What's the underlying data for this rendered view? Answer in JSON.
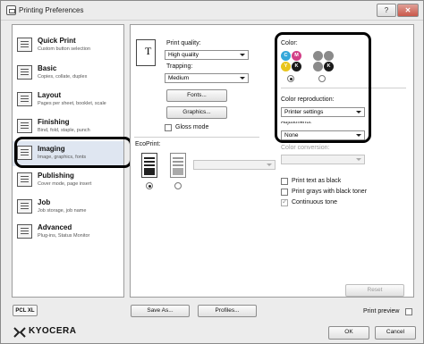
{
  "window": {
    "title": "Printing Preferences",
    "help_label": "?",
    "close_label": "✕"
  },
  "sidebar": {
    "items": [
      {
        "title": "Quick Print",
        "subtitle": "Custom button selection"
      },
      {
        "title": "Basic",
        "subtitle": "Copies, collate, duplex"
      },
      {
        "title": "Layout",
        "subtitle": "Pages per sheet, booklet, scale"
      },
      {
        "title": "Finishing",
        "subtitle": "Bind, fold, staple, punch"
      },
      {
        "title": "Imaging",
        "subtitle": "Image, graphics, fonts"
      },
      {
        "title": "Publishing",
        "subtitle": "Cover mode, page insert"
      },
      {
        "title": "Job",
        "subtitle": "Job storage, job name"
      },
      {
        "title": "Advanced",
        "subtitle": "Plug-ins, Status Monitor"
      }
    ],
    "selected": "Imaging"
  },
  "imaging": {
    "print_quality_label": "Print quality:",
    "print_quality_value": "High quality",
    "trapping_label": "Trapping:",
    "trapping_value": "Medium",
    "fonts_button": "Fonts...",
    "graphics_button": "Graphics...",
    "gloss_mode_label": "Gloss mode",
    "gloss_mode_checked": false,
    "ecoprint_label": "EcoPrint:",
    "ecoprint_select_value": "",
    "color_label": "Color:",
    "color_dots_color": [
      "C",
      "M",
      "Y",
      "K"
    ],
    "color_dots_mono": [
      "K"
    ],
    "color_mode_selected": "color",
    "color_reproduction_label": "Color reproduction:",
    "color_reproduction_value": "Printer settings",
    "adjustments_label": "Adjustments:",
    "adjustments_value": "None",
    "color_conversion_label": "Color conversion:",
    "color_conversion_value": "",
    "print_text_as_black": "Print text as black",
    "print_grays_black": "Print grays with black toner",
    "continuous_tone": "Continuous tone",
    "print_text_as_black_checked": false,
    "print_grays_black_checked": false,
    "continuous_tone_checked": true,
    "reset_button": "Reset"
  },
  "footer": {
    "profile_label": "PCL XL",
    "save_as_button": "Save As...",
    "profiles_button": "Profiles...",
    "print_preview_label": "Print preview",
    "print_preview_checked": false,
    "brand": "KYOCERA",
    "ok_button": "OK",
    "cancel_button": "Cancel"
  },
  "colors": {
    "cyan": "#35a7d9",
    "magenta": "#d23f87",
    "yellow": "#e8c51c",
    "black": "#1a1a1a",
    "mono_gray": "#8a8a8a",
    "selection": "#dfe6f1"
  }
}
